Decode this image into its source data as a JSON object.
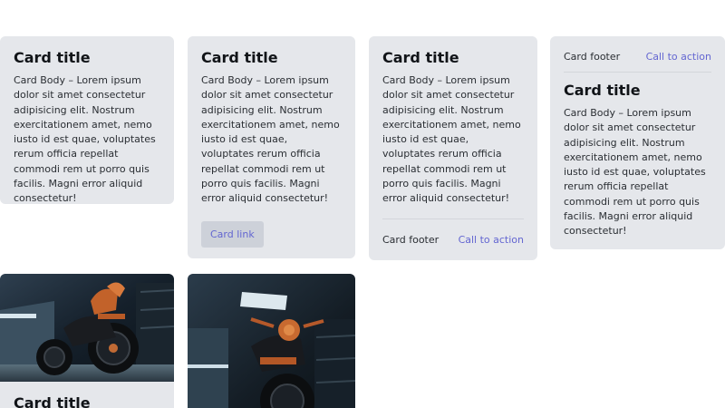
{
  "cards": {
    "card1": {
      "title": "Card title",
      "body": "Card Body – Lorem ipsum dolor sit amet consectetur adipisicing elit. Nostrum exercitationem amet, nemo iusto id est quae, voluptates rerum officia repellat commodi rem ut porro quis facilis. Magni error aliquid consectetur!"
    },
    "card2": {
      "title": "Card title",
      "body": "Card Body – Lorem ipsum dolor sit amet consectetur adipisicing elit. Nostrum exercitationem amet, nemo iusto id est quae, voluptates rerum officia repellat commodi rem ut porro quis facilis. Magni error aliquid consectetur!",
      "link_label": "Card link"
    },
    "card3": {
      "title": "Card title",
      "body": "Card Body – Lorem ipsum dolor sit amet consectetur adipisicing elit. Nostrum exercitationem amet, nemo iusto id est quae, voluptates rerum officia repellat commodi rem ut porro quis facilis. Magni error aliquid consectetur!",
      "footer": "Card footer",
      "cta": "Call to action"
    },
    "card4": {
      "header": "Card footer",
      "cta": "Call to action",
      "title": "Card title",
      "body": "Card Body – Lorem ipsum dolor sit amet consectetur adipisicing elit. Nostrum exercitationem amet, nemo iusto id est quae, voluptates rerum officia repellat commodi rem ut porro quis facilis. Magni error aliquid consectetur!"
    },
    "card5": {
      "title": "Card title"
    }
  },
  "colors": {
    "card_bg": "#e5e7eb",
    "accent": "#6366d1",
    "button_bg": "#cdd1d9"
  }
}
